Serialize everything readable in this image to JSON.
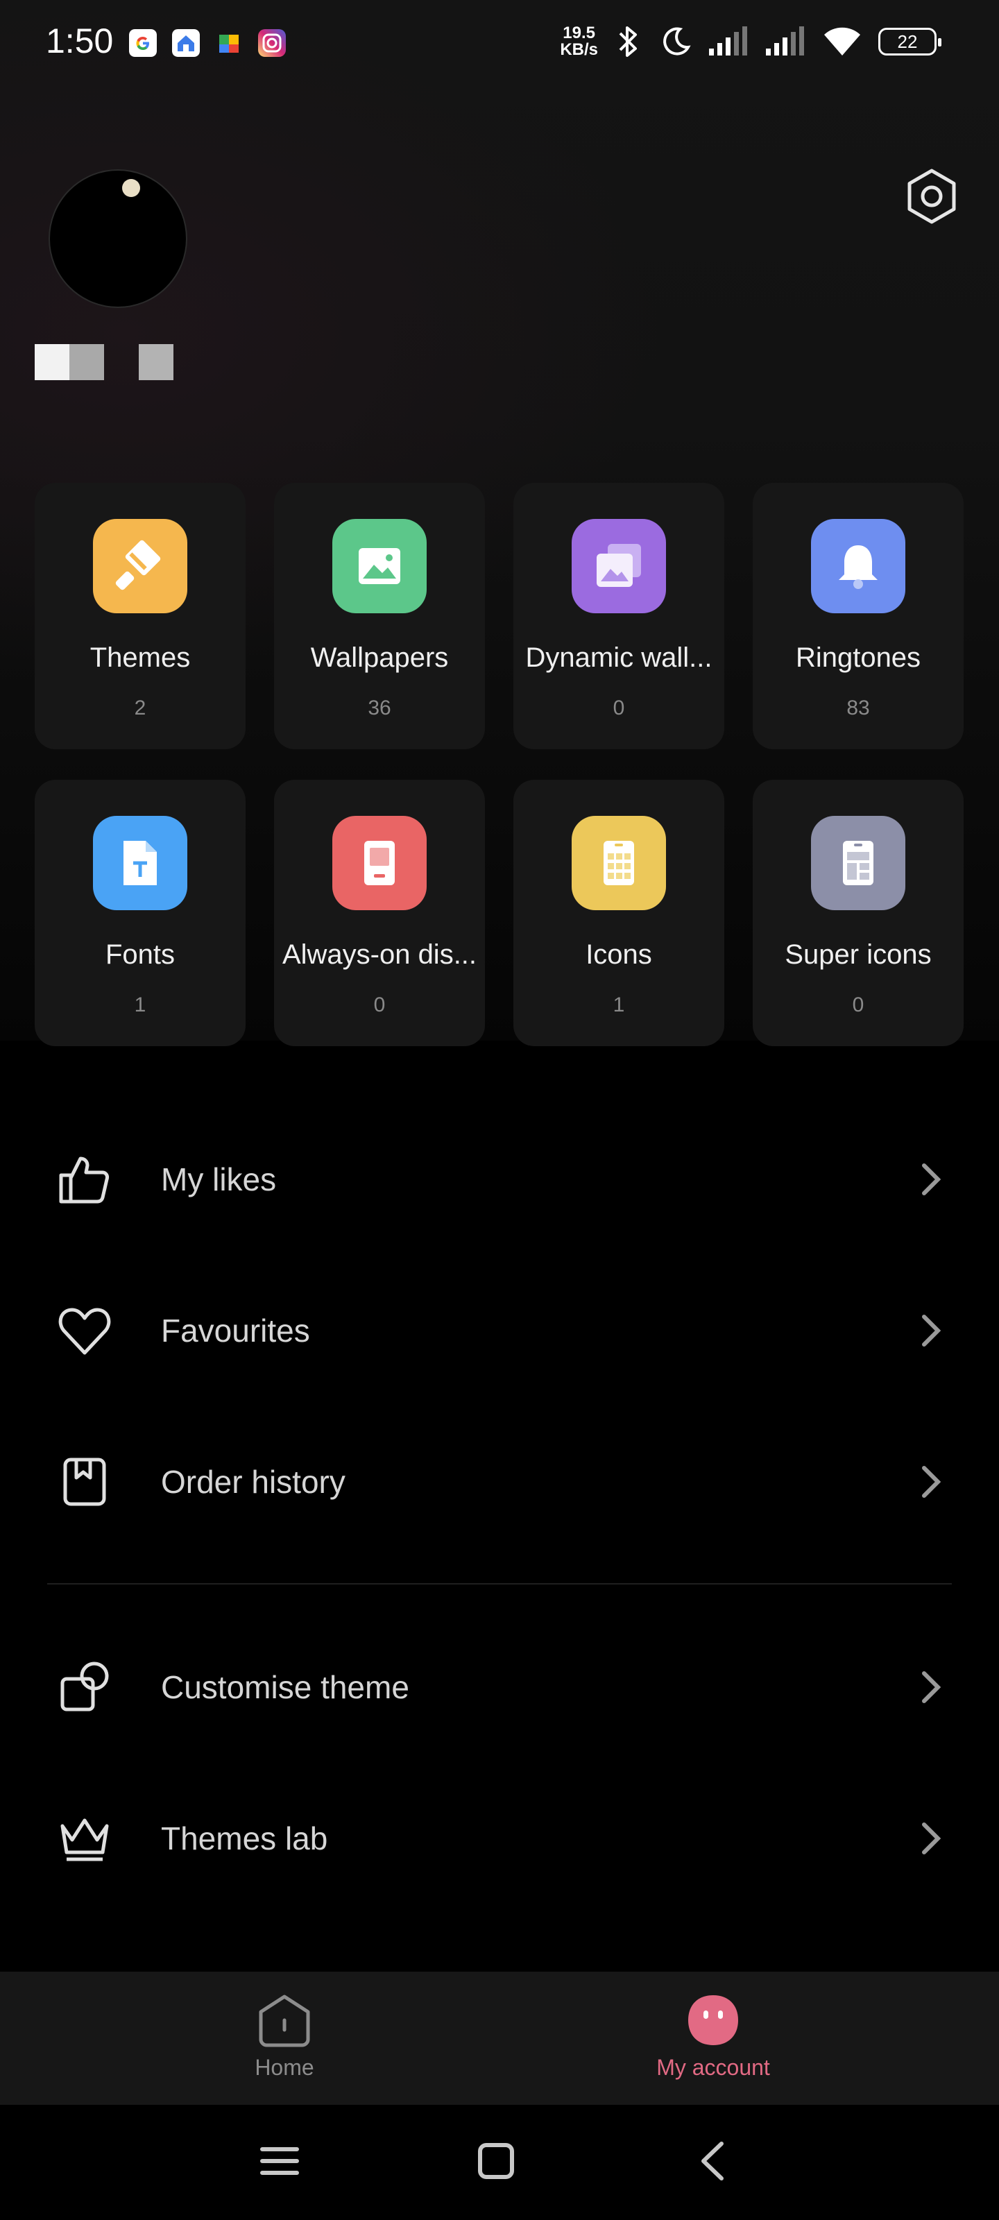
{
  "status_bar": {
    "time": "1:50",
    "net_speed_value": "19.5",
    "net_speed_unit": "KB/s",
    "battery": "22",
    "notification_icons": [
      "google-icon",
      "home-app-icon",
      "puzzle-app-icon",
      "instagram-icon"
    ]
  },
  "categories": [
    {
      "label": "Themes",
      "count": "2",
      "icon": "theme-brush-icon",
      "color": "#F5B74E"
    },
    {
      "label": "Wallpapers",
      "count": "36",
      "icon": "wallpaper-image-icon",
      "color": "#5CC78A"
    },
    {
      "label": "Dynamic wall...",
      "count": "0",
      "icon": "dynamic-wallpaper-icon",
      "color": "#9B6BE0"
    },
    {
      "label": "Ringtones",
      "count": "83",
      "icon": "bell-icon",
      "color": "#6E8EF0"
    },
    {
      "label": "Fonts",
      "count": "1",
      "icon": "font-file-icon",
      "color": "#4AA3F5"
    },
    {
      "label": "Always-on dis...",
      "count": "0",
      "icon": "always-on-display-icon",
      "color": "#E96565"
    },
    {
      "label": "Icons",
      "count": "1",
      "icon": "icons-grid-icon",
      "color": "#ECC85A"
    },
    {
      "label": "Super icons",
      "count": "0",
      "icon": "super-icons-icon",
      "color": "#8C8FA8"
    }
  ],
  "menu": [
    {
      "label": "My likes",
      "icon": "thumbs-up-icon"
    },
    {
      "label": "Favourites",
      "icon": "heart-icon"
    },
    {
      "label": "Order history",
      "icon": "order-history-icon"
    },
    {
      "label": "Customise theme",
      "icon": "customise-theme-icon"
    },
    {
      "label": "Themes lab",
      "icon": "crown-icon"
    }
  ],
  "tabbar": {
    "home_label": "Home",
    "account_label": "My account",
    "active_color": "#E26A84"
  }
}
